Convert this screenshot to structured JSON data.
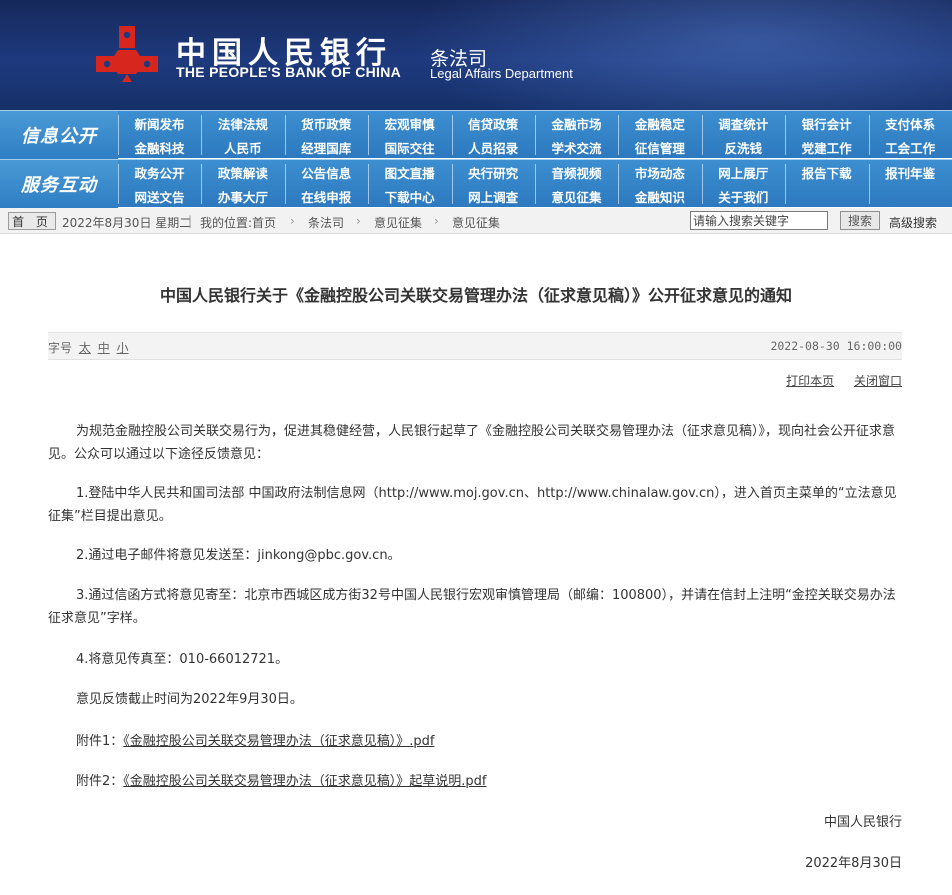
{
  "header": {
    "bank_name_cn": "中国人民银行",
    "bank_name_en": "THE PEOPLE'S BANK OF CHINA",
    "dept_cn": "条法司",
    "dept_en": "Legal Affairs Department"
  },
  "nav": {
    "section1": "信息公开",
    "section2": "服务互动",
    "row1": [
      "新闻发布",
      "法律法规",
      "货币政策",
      "宏观审慎",
      "信贷政策",
      "金融市场",
      "金融稳定",
      "调查统计",
      "银行会计",
      "支付体系"
    ],
    "row2": [
      "金融科技",
      "人民币",
      "经理国库",
      "国际交往",
      "人员招录",
      "学术交流",
      "征信管理",
      "反洗钱",
      "党建工作",
      "工会工作"
    ],
    "row3": [
      "政务公开",
      "政策解读",
      "公告信息",
      "图文直播",
      "央行研究",
      "音频视频",
      "市场动态",
      "网上展厅",
      "报告下载",
      "报刊年鉴"
    ],
    "row4": [
      "网送文告",
      "办事大厅",
      "在线申报",
      "下载中心",
      "网上调查",
      "意见征集",
      "金融知识",
      "关于我们"
    ]
  },
  "breadcrumb": {
    "home_label": "首 页",
    "date": "2022年8月30日 星期二",
    "location_label": "我的位置:首页",
    "crumbs": [
      "条法司",
      "意见征集",
      "意见征集"
    ],
    "search_placeholder": "请输入搜索关键字",
    "search_button": "搜索",
    "advanced_search": "高级搜索"
  },
  "article": {
    "title": "中国人民银行关于《金融控股公司关联交易管理办法（征求意见稿）》公开征求意见的通知",
    "font_label": "字号",
    "font_sizes": [
      "太",
      "中",
      "小"
    ],
    "datetime": "2022-08-30 16:00:00",
    "print_label": "打印本页",
    "close_label": "关闭窗口",
    "intro": "为规范金融控股公司关联交易行为，促进其稳健经营，人民银行起草了《金融控股公司关联交易管理办法（征求意见稿）》，现向社会公开征求意见。公众可以通过以下途径反馈意见：",
    "item1": "1.登陆中华人民共和国司法部 中国政府法制信息网（http://www.moj.gov.cn、http://www.chinalaw.gov.cn），进入首页主菜单的“立法意见征集”栏目提出意见。",
    "item2": "2.通过电子邮件将意见发送至：jinkong@pbc.gov.cn。",
    "item3": "3.通过信函方式将意见寄至：北京市西城区成方街32号中国人民银行宏观审慎管理局（邮编：100800），并请在信封上注明“金控关联交易办法征求意见”字样。",
    "item4": "4.将意见传真至：010-66012721。",
    "deadline": "意见反馈截止时间为2022年9月30日。",
    "attachment1_label": "附件1：",
    "attachment1_link": "《金融控股公司关联交易管理办法（征求意见稿）》.pdf",
    "attachment2_label": "附件2：",
    "attachment2_link": "《金融控股公司关联交易管理办法（征求意见稿）》起草说明.pdf",
    "signature": "中国人民银行",
    "sign_date": "2022年8月30日"
  },
  "colors": {
    "header_bg": "#1e3a7e",
    "nav_bg": "#2d79bf",
    "logo_red": "#d7261e"
  }
}
